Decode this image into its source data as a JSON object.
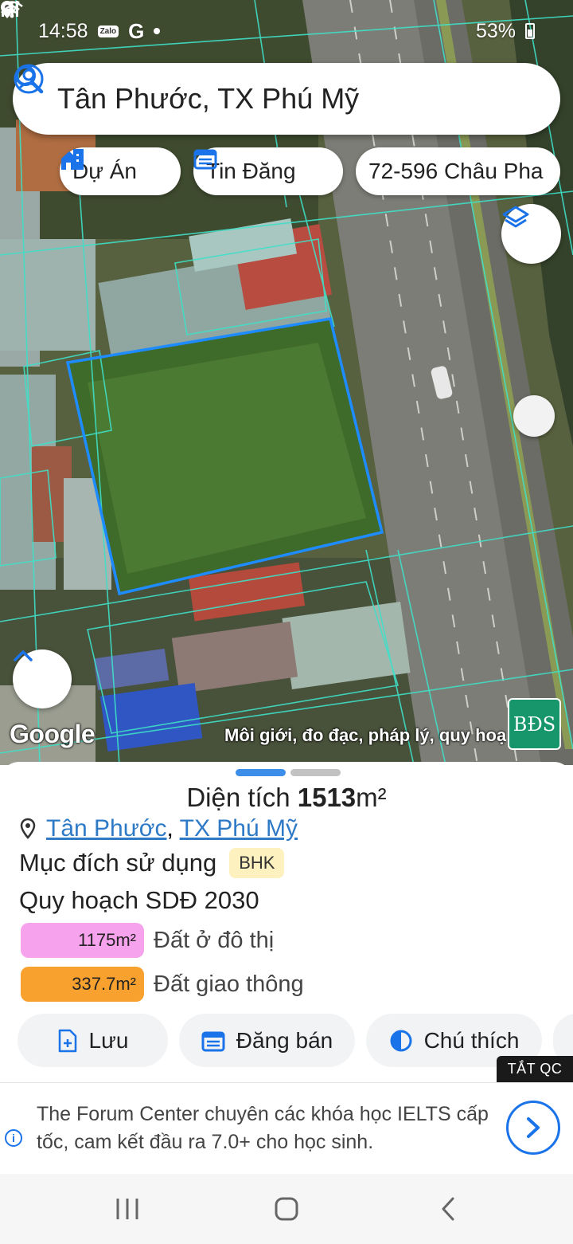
{
  "status_bar": {
    "time": "14:58",
    "zalo": "Zalo",
    "g": "G",
    "battery": "53%"
  },
  "search": {
    "query": "Tân Phước, TX Phú Mỹ"
  },
  "chips": {
    "du_an": "Dự Án",
    "tin_dang": "Tin Đăng",
    "address": "72-596 Châu Pha"
  },
  "map": {
    "google_label": "Google",
    "caption": "Môi giới, đo đạc, pháp lý, quy hoạch",
    "bds_logo": "BĐS"
  },
  "sheet": {
    "area_label": "Diện tích",
    "area_value": "1513",
    "area_unit": "m²",
    "location": {
      "ward": "Tân Phước",
      "separator": ", ",
      "town": "TX Phú Mỹ"
    },
    "purpose_label": "Mục đích sử dụng",
    "purpose_code": "BHK",
    "plan_label": "Quy hoạch SDĐ 2030",
    "zones": [
      {
        "area": "1175m²",
        "name": "Đất ở đô thị",
        "color": "#f7a2ec"
      },
      {
        "area": "337.7m²",
        "name": "Đất giao thông",
        "color": "#f9a12e"
      }
    ],
    "actions": {
      "save": "Lưu",
      "post_sale": "Đăng bán",
      "legend": "Chú thích"
    }
  },
  "ad": {
    "close_label": "TẮT QC",
    "text": "The Forum Center chuyên các khóa học IELTS cấp tốc, cam kết đầu ra 7.0+ cho học sinh."
  },
  "colors": {
    "accent": "#2e7ac6",
    "parcel_outline": "#1e8cff",
    "cadastral_lines": "#3fe0c8"
  }
}
